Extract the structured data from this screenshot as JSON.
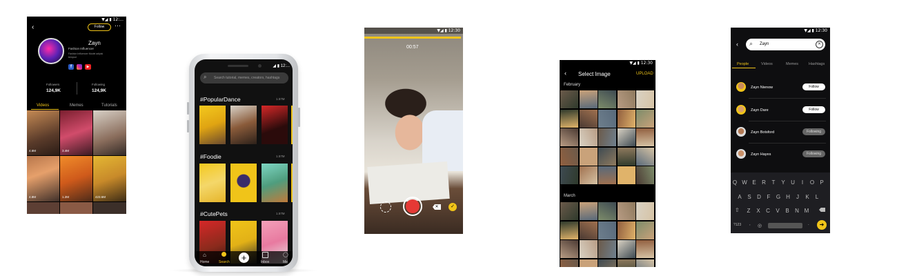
{
  "status": {
    "time": "12:30",
    "time_short": "12:..."
  },
  "profile": {
    "follow_label": "Follow",
    "more_icon": "more-icon",
    "name": "Zayn",
    "subtitle": "Fashion Influencer",
    "bio": "Fashion Influencer Model adipisi tempod",
    "followers_label": "Followers",
    "followers_value": "124,9K",
    "following_label": "Following",
    "following_value": "124,9K",
    "tabs": [
      "Videos",
      "Memes",
      "Tutorials"
    ],
    "views": [
      "4.6M",
      "3.4M",
      "4.8M",
      "1.2M",
      "423.6M"
    ]
  },
  "search_screen": {
    "placeholder": "Search tutorial, memes, creators, hashtags",
    "sections": [
      {
        "tag": "#PopularDance",
        "count": "1.57M"
      },
      {
        "tag": "#Foodie",
        "count": "1.57M"
      },
      {
        "tag": "#CutePets",
        "count": "1.57M"
      }
    ],
    "nav": [
      "Home",
      "Search",
      "Inbox",
      "Me"
    ]
  },
  "camera": {
    "timer": "00:57"
  },
  "select_image": {
    "title": "Select Image",
    "upload": "UPLOAD",
    "months": [
      "February",
      "March"
    ]
  },
  "people_search": {
    "query": "Zayn",
    "tabs": [
      "People",
      "Videos",
      "Memes",
      "Hashtags"
    ],
    "results": [
      {
        "name": "Zayn Nienow",
        "action": "Follow"
      },
      {
        "name": "Zayn Dare",
        "action": "Follow"
      },
      {
        "name": "Zayn Botsford",
        "action": "Following"
      },
      {
        "name": "Zayn Hayes",
        "action": "Following"
      }
    ],
    "keyboard": {
      "row1": [
        "Q",
        "W",
        "E",
        "R",
        "T",
        "Y",
        "U",
        "I",
        "O",
        "P"
      ],
      "row2": [
        "A",
        "S",
        "D",
        "F",
        "G",
        "H",
        "J",
        "K",
        "L"
      ],
      "row3": [
        "Z",
        "X",
        "C",
        "V",
        "B",
        "N",
        "M"
      ],
      "mode_key": "?123"
    }
  },
  "colors": {
    "accent": "#f0c419",
    "record": "#e53935",
    "background": "#000000"
  }
}
